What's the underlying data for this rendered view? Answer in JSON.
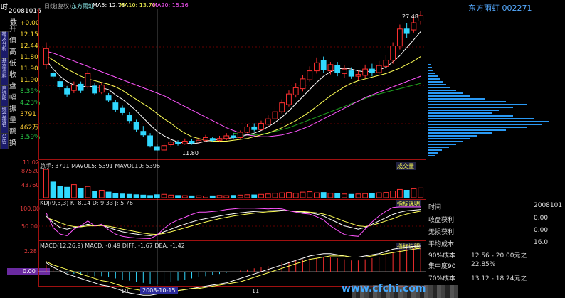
{
  "title_bar": {
    "period_label": "时",
    "chart_mode": "日线(复权)",
    "stock_name": "东方雨虹",
    "ma5": "MA5: 12.73",
    "ma10": "MA10: 13.70",
    "ma20": "MA20: 15.16",
    "colors": {
      "ma5": "#ffffff",
      "ma10": "#ffff55",
      "ma20": "#ff55ff"
    }
  },
  "left_info": {
    "date": "20081016",
    "value_label": "数",
    "items": [
      {
        "k": "开",
        "v": "+0.00"
      },
      {
        "k": "值",
        "v": "12.15"
      },
      {
        "k": "高",
        "v": "12.44"
      },
      {
        "k": "低",
        "v": "11.80"
      },
      {
        "k": "收",
        "v": "11.90"
      },
      {
        "k": "盘",
        "v": "11.90"
      },
      {
        "k": "幅",
        "v": "8.35%"
      },
      {
        "k": "振",
        "v": "4.23%"
      },
      {
        "k": "量",
        "v": "3791"
      },
      {
        "k": "额",
        "v": "462万"
      },
      {
        "k": "换",
        "v": "3.59%"
      }
    ],
    "vertical_tabs": [
      "技术分析",
      "基本资料",
      "自选股",
      "综合排名",
      "公告"
    ]
  },
  "price_axis": {
    "top_label": "27.48",
    "bottom_label": "11.02",
    "low_marker": "11.80"
  },
  "volume_panel": {
    "label": "总手: 3791  MAVOL5: 5391  MAVOL10: 5396",
    "button": "成交量",
    "axis": [
      "87520",
      "43760"
    ]
  },
  "kdj_panel": {
    "label": "KDJ(9,3,3)  K: 8.14  D: 9.33  J: 5.76",
    "button": "指标说明",
    "axis": [
      "100.00",
      "50.00"
    ]
  },
  "macd_panel": {
    "label": "MACD(12,26,9)  MACD: -0.49  DIFF: -1.67  DEA: -1.42",
    "button": "指标说明",
    "axis": [
      "2.28",
      "0.00"
    ]
  },
  "x_axis": {
    "labels": [
      "10",
      "2008-10-15",
      "11"
    ],
    "cursor_date": "2008-10-15"
  },
  "right_panel": {
    "header": "东方雨虹  002271",
    "top_price": "27.48",
    "rows": [
      {
        "k": "时间",
        "v": "2008101"
      },
      {
        "k": "收盘获利",
        "v": "0.00"
      },
      {
        "k": "无损获利",
        "v": "0.00"
      },
      {
        "k": "平均成本",
        "v": "16.0"
      },
      {
        "k": "90%成本",
        "v": "12.56 - 20.00元之"
      },
      {
        "k": "集中度90",
        "v": "22.85%"
      },
      {
        "k": "70%成本",
        "v": "13.12 - 18.24元之"
      }
    ]
  },
  "watermark": "www.cfchi.com",
  "chart_data": [
    {
      "type": "candlestick",
      "title": "",
      "ylim": [
        11.02,
        27.48
      ],
      "candles": [
        {
          "o": 21.5,
          "c": 23.3,
          "h": 24.0,
          "l": 21.0
        },
        {
          "o": 20.5,
          "c": 20.2,
          "h": 21.0,
          "l": 19.9
        },
        {
          "o": 19.6,
          "c": 19.0,
          "h": 20.0,
          "l": 18.7
        },
        {
          "o": 18.8,
          "c": 18.2,
          "h": 19.1,
          "l": 17.9
        },
        {
          "o": 18.6,
          "c": 19.2,
          "h": 19.6,
          "l": 18.3
        },
        {
          "o": 19.3,
          "c": 18.6,
          "h": 19.6,
          "l": 18.3
        },
        {
          "o": 19.0,
          "c": 20.5,
          "h": 20.9,
          "l": 18.8
        },
        {
          "o": 19.1,
          "c": 18.3,
          "h": 19.4,
          "l": 18.1
        },
        {
          "o": 18.4,
          "c": 19.2,
          "h": 19.5,
          "l": 18.2
        },
        {
          "o": 18.0,
          "c": 17.5,
          "h": 18.3,
          "l": 17.3
        },
        {
          "o": 17.2,
          "c": 16.5,
          "h": 17.5,
          "l": 16.2
        },
        {
          "o": 16.6,
          "c": 16.1,
          "h": 16.9,
          "l": 15.8
        },
        {
          "o": 15.8,
          "c": 15.2,
          "h": 16.2,
          "l": 14.9
        },
        {
          "o": 15.0,
          "c": 14.2,
          "h": 15.3,
          "l": 13.9
        },
        {
          "o": 14.0,
          "c": 13.6,
          "h": 14.6,
          "l": 13.4
        },
        {
          "o": 13.5,
          "c": 12.4,
          "h": 13.8,
          "l": 12.2
        },
        {
          "o": 12.3,
          "c": 11.9,
          "h": 12.6,
          "l": 11.8
        },
        {
          "o": 11.9,
          "c": 12.4,
          "h": 12.7,
          "l": 11.8
        },
        {
          "o": 12.5,
          "c": 12.8,
          "h": 13.1,
          "l": 12.3
        },
        {
          "o": 12.8,
          "c": 12.6,
          "h": 13.0,
          "l": 12.4
        },
        {
          "o": 12.6,
          "c": 12.9,
          "h": 13.2,
          "l": 12.5
        },
        {
          "o": 12.9,
          "c": 12.7,
          "h": 13.1,
          "l": 12.5
        },
        {
          "o": 12.8,
          "c": 13.0,
          "h": 13.3,
          "l": 12.6
        },
        {
          "o": 13.0,
          "c": 13.3,
          "h": 13.6,
          "l": 12.8
        },
        {
          "o": 13.2,
          "c": 13.0,
          "h": 13.4,
          "l": 12.8
        },
        {
          "o": 13.0,
          "c": 13.2,
          "h": 13.5,
          "l": 12.9
        },
        {
          "o": 13.2,
          "c": 13.5,
          "h": 13.8,
          "l": 13.0
        },
        {
          "o": 13.5,
          "c": 13.3,
          "h": 13.8,
          "l": 13.1
        },
        {
          "o": 13.3,
          "c": 13.9,
          "h": 14.1,
          "l": 13.2
        },
        {
          "o": 13.9,
          "c": 14.5,
          "h": 14.8,
          "l": 13.8
        },
        {
          "o": 14.5,
          "c": 14.2,
          "h": 14.9,
          "l": 14.0
        },
        {
          "o": 14.2,
          "c": 14.9,
          "h": 15.2,
          "l": 14.1
        },
        {
          "o": 14.8,
          "c": 15.4,
          "h": 15.8,
          "l": 14.6
        },
        {
          "o": 15.4,
          "c": 16.2,
          "h": 16.8,
          "l": 15.2
        },
        {
          "o": 16.2,
          "c": 17.2,
          "h": 17.6,
          "l": 16.0
        },
        {
          "o": 17.0,
          "c": 18.2,
          "h": 18.6,
          "l": 16.8
        },
        {
          "o": 18.1,
          "c": 18.9,
          "h": 19.4,
          "l": 17.8
        },
        {
          "o": 18.8,
          "c": 19.9,
          "h": 20.3,
          "l": 18.5
        },
        {
          "o": 19.8,
          "c": 20.8,
          "h": 21.3,
          "l": 19.6
        },
        {
          "o": 20.8,
          "c": 21.7,
          "h": 22.3,
          "l": 20.5
        },
        {
          "o": 22.0,
          "c": 20.9,
          "h": 22.4,
          "l": 20.6
        },
        {
          "o": 20.8,
          "c": 21.5,
          "h": 21.8,
          "l": 20.4
        },
        {
          "o": 21.4,
          "c": 20.6,
          "h": 21.8,
          "l": 20.2
        },
        {
          "o": 20.5,
          "c": 21.0,
          "h": 21.4,
          "l": 20.0
        },
        {
          "o": 20.8,
          "c": 20.2,
          "h": 21.2,
          "l": 19.9
        },
        {
          "o": 20.2,
          "c": 20.4,
          "h": 20.8,
          "l": 19.8
        },
        {
          "o": 20.3,
          "c": 21.0,
          "h": 21.5,
          "l": 20.0
        },
        {
          "o": 21.0,
          "c": 20.6,
          "h": 21.6,
          "l": 20.2
        },
        {
          "o": 20.6,
          "c": 21.4,
          "h": 21.9,
          "l": 20.3
        },
        {
          "o": 21.3,
          "c": 22.0,
          "h": 22.6,
          "l": 21.0
        },
        {
          "o": 22.0,
          "c": 23.6,
          "h": 24.0,
          "l": 21.6
        },
        {
          "o": 23.6,
          "c": 25.5,
          "h": 26.0,
          "l": 23.2
        },
        {
          "o": 25.5,
          "c": 25.0,
          "h": 26.2,
          "l": 24.5
        },
        {
          "o": 25.4,
          "c": 26.2,
          "h": 27.0,
          "l": 25.1
        },
        {
          "o": 26.4,
          "c": 27.0,
          "h": 27.48,
          "l": 26.0
        }
      ],
      "ma5": [
        22.0,
        21.0,
        20.2,
        19.6,
        19.2,
        19.0,
        19.1,
        19.0,
        18.9,
        18.7,
        18.1,
        17.6,
        17.0,
        16.3,
        15.5,
        14.7,
        14.0,
        13.5,
        13.1,
        12.8,
        12.7,
        12.6,
        12.7,
        12.9,
        13.0,
        13.1,
        13.2,
        13.3,
        13.4,
        13.6,
        13.8,
        14.1,
        14.5,
        15.0,
        15.6,
        16.3,
        17.1,
        17.9,
        18.7,
        19.5,
        20.2,
        20.7,
        21.0,
        21.1,
        21.0,
        20.8,
        20.7,
        20.8,
        20.9,
        21.2,
        21.8,
        22.5,
        23.4,
        24.3,
        25.2
      ],
      "ma10": [
        22.5,
        22.0,
        21.5,
        21.0,
        20.6,
        20.2,
        19.9,
        19.7,
        19.5,
        19.3,
        19.0,
        18.6,
        18.1,
        17.6,
        17.1,
        16.6,
        16.0,
        15.4,
        14.9,
        14.3,
        13.8,
        13.4,
        13.2,
        13.0,
        12.9,
        12.9,
        12.9,
        13.0,
        13.1,
        13.2,
        13.4,
        13.6,
        13.8,
        14.1,
        14.4,
        14.8,
        15.2,
        15.7,
        16.2,
        16.8,
        17.4,
        18.0,
        18.5,
        19.0,
        19.4,
        19.7,
        19.9,
        20.1,
        20.3,
        20.5,
        20.8,
        21.1,
        21.5,
        21.9,
        22.4
      ],
      "ma20": [
        23.0,
        22.8,
        22.5,
        22.2,
        21.9,
        21.6,
        21.3,
        21.0,
        20.7,
        20.4,
        20.1,
        19.8,
        19.5,
        19.2,
        18.9,
        18.6,
        18.3,
        18.0,
        17.6,
        17.2,
        16.8,
        16.4,
        16.0,
        15.6,
        15.2,
        14.8,
        14.4,
        14.1,
        13.8,
        13.6,
        13.5,
        13.4,
        13.4,
        13.5,
        13.6,
        13.8,
        14.0,
        14.3,
        14.6,
        15.0,
        15.4,
        15.8,
        16.2,
        16.6,
        17.0,
        17.4,
        17.8,
        18.1,
        18.4,
        18.7,
        19.0,
        19.3,
        19.6,
        19.9,
        20.2
      ],
      "ma60": [
        null,
        null,
        null,
        null,
        null,
        null,
        null,
        null,
        null,
        null,
        null,
        null,
        null,
        null,
        null,
        null,
        null,
        null,
        null,
        null,
        null,
        null,
        null,
        null,
        null,
        null,
        null,
        13.8,
        13.7,
        13.6,
        13.6,
        13.7,
        13.8,
        14.0,
        14.2,
        14.4,
        14.7,
        15.0,
        15.3,
        15.6,
        15.9,
        16.2,
        16.5,
        16.8,
        17.1,
        17.4,
        17.7,
        18.0,
        18.2,
        18.4,
        18.6,
        18.8,
        19.0,
        19.2,
        19.4
      ]
    },
    {
      "type": "bar",
      "title": "",
      "ylim": [
        0,
        87520
      ],
      "values": [
        76000,
        42000,
        30000,
        28000,
        35000,
        25000,
        30000,
        18000,
        20000,
        15000,
        12000,
        10000,
        9000,
        8000,
        7000,
        6000,
        8000,
        9000,
        7000,
        6000,
        5500,
        5000,
        5200,
        4800,
        5000,
        6000,
        5500,
        6200,
        7000,
        8000,
        7500,
        9000,
        10000,
        12000,
        13000,
        14000,
        12000,
        15000,
        16000,
        13000,
        14000,
        12000,
        11000,
        10000,
        9000,
        10000,
        11000,
        12000,
        13000,
        14000,
        18000,
        22000,
        20000,
        24000,
        26000
      ]
    },
    {
      "type": "line",
      "title": "",
      "ylim": [
        0,
        100
      ],
      "series": [
        {
          "name": "K",
          "values": [
            70,
            50,
            35,
            30,
            35,
            38,
            45,
            40,
            42,
            35,
            28,
            22,
            18,
            15,
            12,
            10,
            14,
            22,
            30,
            38,
            45,
            52,
            58,
            62,
            66,
            70,
            74,
            77,
            80,
            82,
            84,
            85,
            86,
            87,
            88,
            86,
            84,
            82,
            80,
            76,
            70,
            60,
            50,
            40,
            35,
            30,
            35,
            45,
            55,
            65,
            75,
            82,
            86,
            88,
            90
          ]
        },
        {
          "name": "D",
          "values": [
            65,
            58,
            50,
            42,
            38,
            37,
            40,
            40,
            41,
            39,
            35,
            30,
            26,
            22,
            18,
            15,
            14,
            17,
            22,
            28,
            34,
            40,
            46,
            52,
            57,
            62,
            66,
            70,
            73,
            76,
            79,
            81,
            83,
            84,
            86,
            86,
            85,
            84,
            82,
            80,
            76,
            70,
            62,
            54,
            47,
            40,
            38,
            42,
            48,
            55,
            62,
            70,
            76,
            81,
            85
          ]
        },
        {
          "name": "J",
          "values": [
            80,
            35,
            15,
            10,
            30,
            40,
            55,
            40,
            45,
            28,
            15,
            8,
            5,
            3,
            2,
            1,
            12,
            32,
            48,
            58,
            66,
            75,
            82,
            82,
            84,
            86,
            90,
            92,
            94,
            94,
            94,
            93,
            92,
            93,
            92,
            86,
            82,
            78,
            76,
            68,
            58,
            40,
            26,
            14,
            10,
            8,
            30,
            52,
            70,
            85,
            96,
            98,
            98,
            98,
            98
          ]
        }
      ]
    },
    {
      "type": "bar",
      "title": "",
      "ylim": [
        -2.28,
        2.28
      ],
      "values": [
        0.6,
        0.3,
        0.1,
        -0.1,
        -0.2,
        -0.3,
        -0.3,
        -0.4,
        -0.4,
        -0.5,
        -0.6,
        -0.7,
        -0.8,
        -0.9,
        -1.0,
        -1.1,
        -1.1,
        -1.0,
        -0.9,
        -0.8,
        -0.7,
        -0.6,
        -0.5,
        -0.4,
        -0.3,
        -0.2,
        -0.1,
        0.0,
        0.1,
        0.2,
        0.3,
        0.4,
        0.5,
        0.6,
        0.8,
        0.9,
        1.0,
        1.1,
        1.2,
        1.2,
        1.3,
        1.3,
        1.2,
        1.1,
        1.0,
        1.0,
        1.1,
        1.2,
        1.3,
        1.5,
        1.7,
        1.9,
        2.0,
        2.1,
        2.2
      ],
      "series": [
        {
          "name": "DIFF",
          "values": [
            0.8,
            0.4,
            0.1,
            -0.2,
            -0.4,
            -0.6,
            -0.8,
            -1.0,
            -1.2,
            -1.3,
            -1.5,
            -1.7,
            -1.9,
            -2.0,
            -2.1,
            -2.1,
            -2.0,
            -1.9,
            -1.8,
            -1.7,
            -1.6,
            -1.5,
            -1.4,
            -1.3,
            -1.2,
            -1.1,
            -1.0,
            -0.8,
            -0.6,
            -0.4,
            -0.2,
            0.0,
            0.2,
            0.4,
            0.6,
            0.8,
            1.0,
            1.2,
            1.4,
            1.5,
            1.6,
            1.6,
            1.5,
            1.4,
            1.3,
            1.3,
            1.4,
            1.5,
            1.6,
            1.8,
            2.0,
            2.1,
            2.2,
            2.25,
            2.28
          ]
        },
        {
          "name": "DEA",
          "values": [
            0.9,
            0.6,
            0.4,
            0.2,
            0.0,
            -0.2,
            -0.4,
            -0.6,
            -0.8,
            -0.9,
            -1.1,
            -1.3,
            -1.5,
            -1.6,
            -1.7,
            -1.8,
            -1.8,
            -1.8,
            -1.7,
            -1.7,
            -1.6,
            -1.5,
            -1.5,
            -1.4,
            -1.3,
            -1.2,
            -1.1,
            -1.0,
            -0.9,
            -0.7,
            -0.5,
            -0.3,
            -0.1,
            0.1,
            0.3,
            0.5,
            0.7,
            0.9,
            1.1,
            1.2,
            1.3,
            1.4,
            1.4,
            1.4,
            1.3,
            1.3,
            1.3,
            1.4,
            1.5,
            1.6,
            1.7,
            1.8,
            1.9,
            2.0,
            2.1
          ]
        }
      ]
    }
  ]
}
